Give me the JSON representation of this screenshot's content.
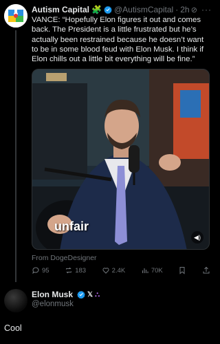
{
  "post": {
    "author_name": "Autism Capital",
    "author_emoji": "🧩",
    "handle": "@AutismCapital",
    "separator": "·",
    "time": "2h",
    "text": "VANCE: “Hopefully Elon figures it out and comes back. The President is a little frustrated but he’s actually been restrained because he doesn’t want to be in some blood feud with Elon Musk. I think if Elon chills out a little bit everything will be fine.”",
    "video_caption": "unfair",
    "source": "From DogeDesigner",
    "stats": {
      "replies": "95",
      "reposts": "183",
      "likes": "2.4K",
      "views": "70K"
    }
  },
  "reply": {
    "author_name": "Elon Musk",
    "x_badge": "𝕏",
    "handle": "@elonmusk",
    "text": "Cool"
  },
  "colors": {
    "background": "#000000",
    "text": "#e7e9ea",
    "muted": "#71767b",
    "verified": "#1d9bf0",
    "thread_line": "#333639"
  },
  "icons": [
    "grok-icon",
    "more-icon",
    "verified-badge-icon",
    "mute-icon",
    "reply-icon",
    "repost-icon",
    "like-icon",
    "views-icon",
    "bookmark-icon",
    "share-icon",
    "affiliate-icon"
  ]
}
